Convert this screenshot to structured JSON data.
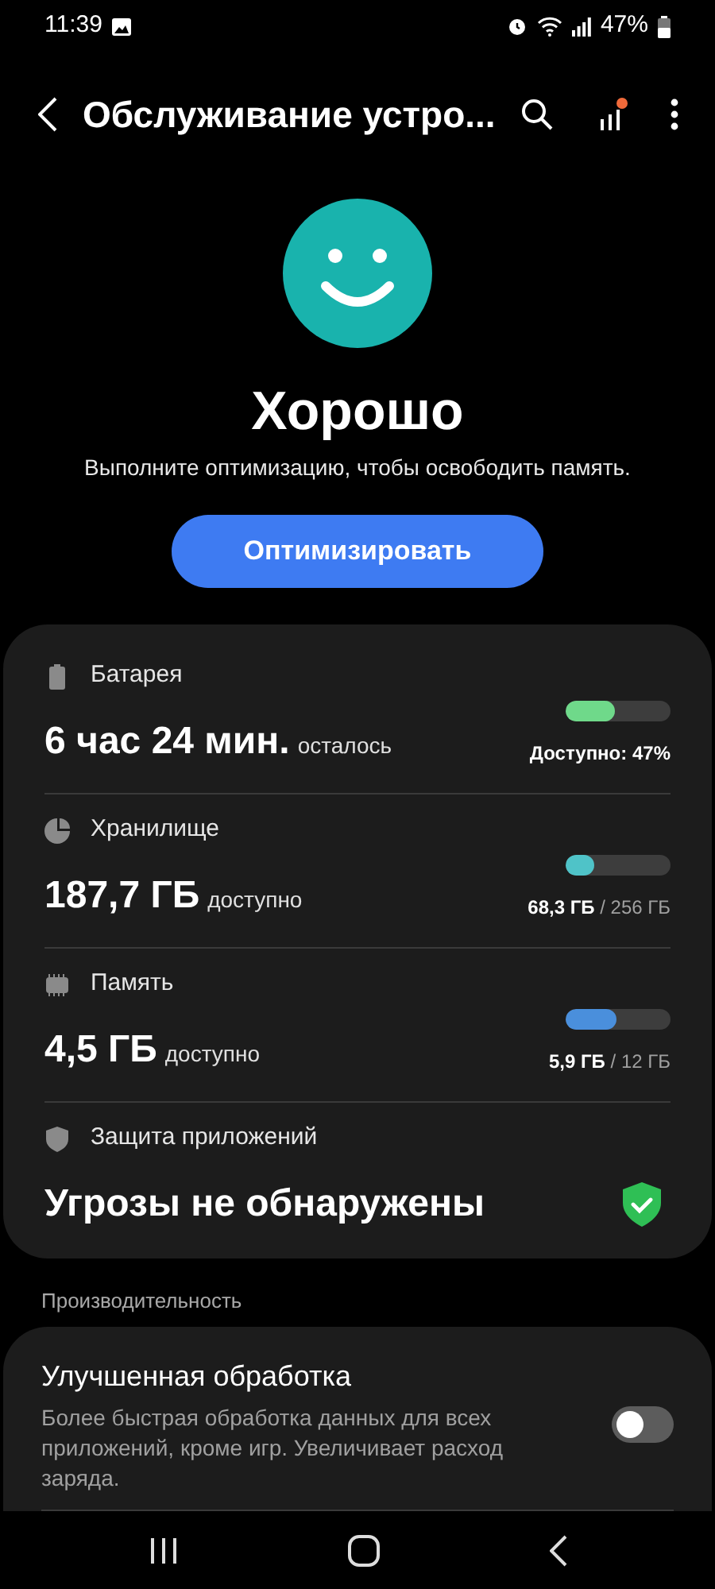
{
  "status_bar": {
    "time": "11:39",
    "battery": "47%"
  },
  "app_bar": {
    "title": "Обслуживание устро..."
  },
  "summary": {
    "status": "Хорошо",
    "message": "Выполните оптимизацию, чтобы освободить память.",
    "button": "Оптимизировать"
  },
  "items": [
    {
      "kind": "battery",
      "label": "Батарея",
      "value": "6 час 24 мин.",
      "suffix": "осталось",
      "level": 0.47,
      "color": "#6fd98a",
      "reading": "Доступно: 47%"
    },
    {
      "kind": "storage",
      "label": "Хранилище",
      "value": "187,7 ГБ",
      "suffix": "доступно",
      "level": 0.27,
      "color": "#4fc3c8",
      "reading": "**68,3 ГБ** / 256 ГБ"
    },
    {
      "kind": "memory",
      "label": "Память",
      "value": "4,5 ГБ",
      "suffix": "доступно",
      "level": 0.49,
      "color": "#4a8fdc",
      "reading": "**5,9 ГБ** / 12 ГБ"
    },
    {
      "kind": "protection",
      "label": "Защита приложений",
      "value": "Угрозы не обнаружены"
    }
  ],
  "section": {
    "title": "Производительность"
  },
  "settings": [
    {
      "title": "Улучшенная обработка",
      "description": "Более быстрая обработка данных для всех приложений, кроме игр. Увеличивает расход заряда.",
      "on": false
    }
  ]
}
